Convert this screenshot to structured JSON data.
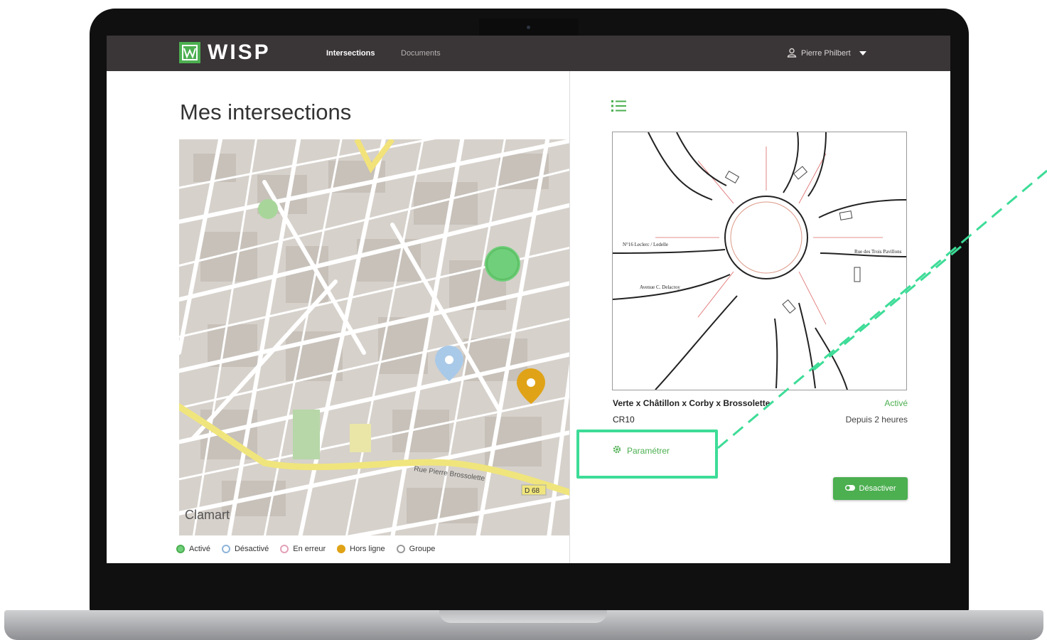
{
  "app": {
    "logo_text": "WISP"
  },
  "nav": {
    "items": [
      {
        "label": "Intersections",
        "active": true
      },
      {
        "label": "Documents",
        "active": false
      }
    ]
  },
  "user": {
    "name": "Pierre Philbert",
    "icon": "user-icon",
    "dropdown_icon": "caret-down-icon"
  },
  "page": {
    "title": "Mes intersections"
  },
  "map": {
    "place_label": "Clamart",
    "street_label": "Rue Pierre Brossolette",
    "road_badge": "D 68",
    "markers": [
      {
        "status": "Activé",
        "color": "#6fcf7a"
      },
      {
        "status": "Désactivé",
        "color": "#a9c9e8"
      },
      {
        "status": "Hors ligne",
        "color": "#e0a317"
      }
    ]
  },
  "legend": [
    {
      "label": "Activé",
      "color": "#6fcf7a",
      "style": "filled"
    },
    {
      "label": "Désactivé",
      "color": "#8fb3d9",
      "style": "outline"
    },
    {
      "label": "En erreur",
      "color": "#e3a0b8",
      "style": "outline"
    },
    {
      "label": "Hors ligne",
      "color": "#e0a317",
      "style": "filled"
    },
    {
      "label": "Groupe",
      "color": "#9a9a9a",
      "style": "outline"
    }
  ],
  "detail": {
    "plan_labels": {
      "left": "N°16 Leclerc / Ledelle",
      "left2": "Avenue C. Delacroy",
      "right": "Rue des Trois Pavillons"
    },
    "name": "Verte x Châtillon x Corby x Brossolette",
    "code": "CR10",
    "status": "Activé",
    "since": "Depuis 2 heures",
    "configure_label": "Paramétrer",
    "deactivate_label": "Désactiver"
  },
  "colors": {
    "accent": "#4caf50",
    "navbar": "#3a3536",
    "highlight": "#3ddc97"
  }
}
